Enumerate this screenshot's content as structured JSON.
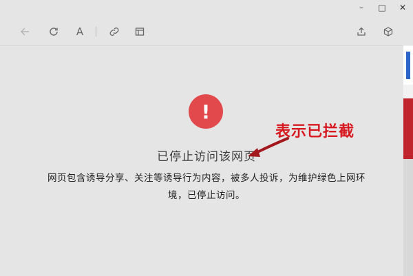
{
  "window": {
    "controls": {
      "minimize": "–",
      "maximize": "□",
      "close": "✕"
    }
  },
  "toolbar": {
    "icons": [
      "back-arrow-icon",
      "refresh-icon",
      "font-size-icon",
      "link-icon",
      "reader-view-icon",
      "share-icon",
      "extension-box-icon"
    ],
    "font_glyph": "A"
  },
  "blocked_page": {
    "icon": "exclamation-icon",
    "icon_glyph": "!",
    "title": "已停止访问该网页",
    "description_line1": "网页包含诱导分享、关注等诱导行为内容，被多人投诉，为维护绿色上网环",
    "description_line2": "境，已停止访问。"
  },
  "annotation": {
    "label": "表示已拦截",
    "color": "#d71920"
  },
  "colors": {
    "badge": "#e2494c",
    "background": "#e5e5e5"
  }
}
